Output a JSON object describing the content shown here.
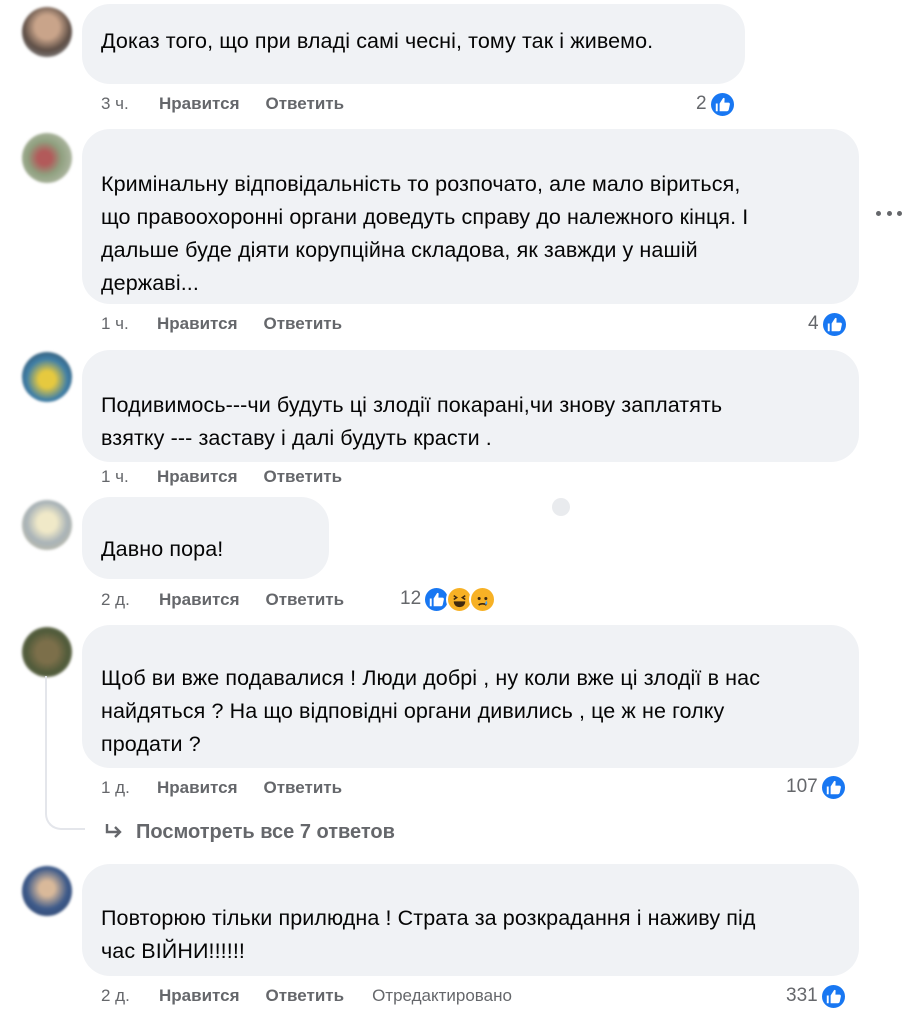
{
  "actions": {
    "like_label": "Нравится",
    "reply_label": "Ответить"
  },
  "comments": [
    {
      "avatar_color": "#7a6b5e",
      "text": "Доказ того, що при владі самі чесні, тому так і живемо.",
      "time": "3 ч.",
      "reaction_count": "2",
      "reactions": [
        "like-icon"
      ]
    },
    {
      "avatar_color": "#8b8f7a",
      "text": "Кримінальну відповідальність то розпочато, але мало віриться,\nщо правоохоронні органи доведуть справу до належного кінця. І\nдальше буде діяти корупційна складова, як завжди у нашій\nдержаві...",
      "time": "1 ч.",
      "reaction_count": "4",
      "reactions": [
        "like-icon"
      ]
    },
    {
      "avatar_color": "#4a6a7a",
      "text": "Подивимось---чи будуть ці злодії покарані,чи знову заплатять\nвзятку --- заставу і далі будуть красти .",
      "time": "1 ч."
    },
    {
      "avatar_color": "#c9c3a8",
      "text": "Давно пора!",
      "time": "2 д.",
      "reaction_count": "12",
      "reactions": [
        "like-icon",
        "haha-icon",
        "sad-icon"
      ]
    },
    {
      "avatar_color": "#6b6a55",
      "text": "Щоб ви вже подавалися ! Люди добрі , ну коли вже ці злодії в нас\nнайдяться ? На що відповідні органи дивились , це ж не голку\nпродати ?",
      "time": "1 д.",
      "reaction_count": "107",
      "reactions": [
        "like-icon"
      ]
    },
    {
      "avatar_color": "#3d5a8a",
      "text": "Повторюю тільки прилюдна ! Страта за розкрадання і наживу під\nчас ВІЙНИ!!!!!!",
      "time": "2 д.",
      "edited_label": "Отредактировано",
      "reaction_count": "331",
      "reactions": [
        "like-icon"
      ]
    }
  ],
  "view_replies_label": "Посмотреть все 7 ответов",
  "colors": {
    "like": "#1877f2",
    "bubble": "#f0f2f5",
    "meta": "#65676b"
  }
}
